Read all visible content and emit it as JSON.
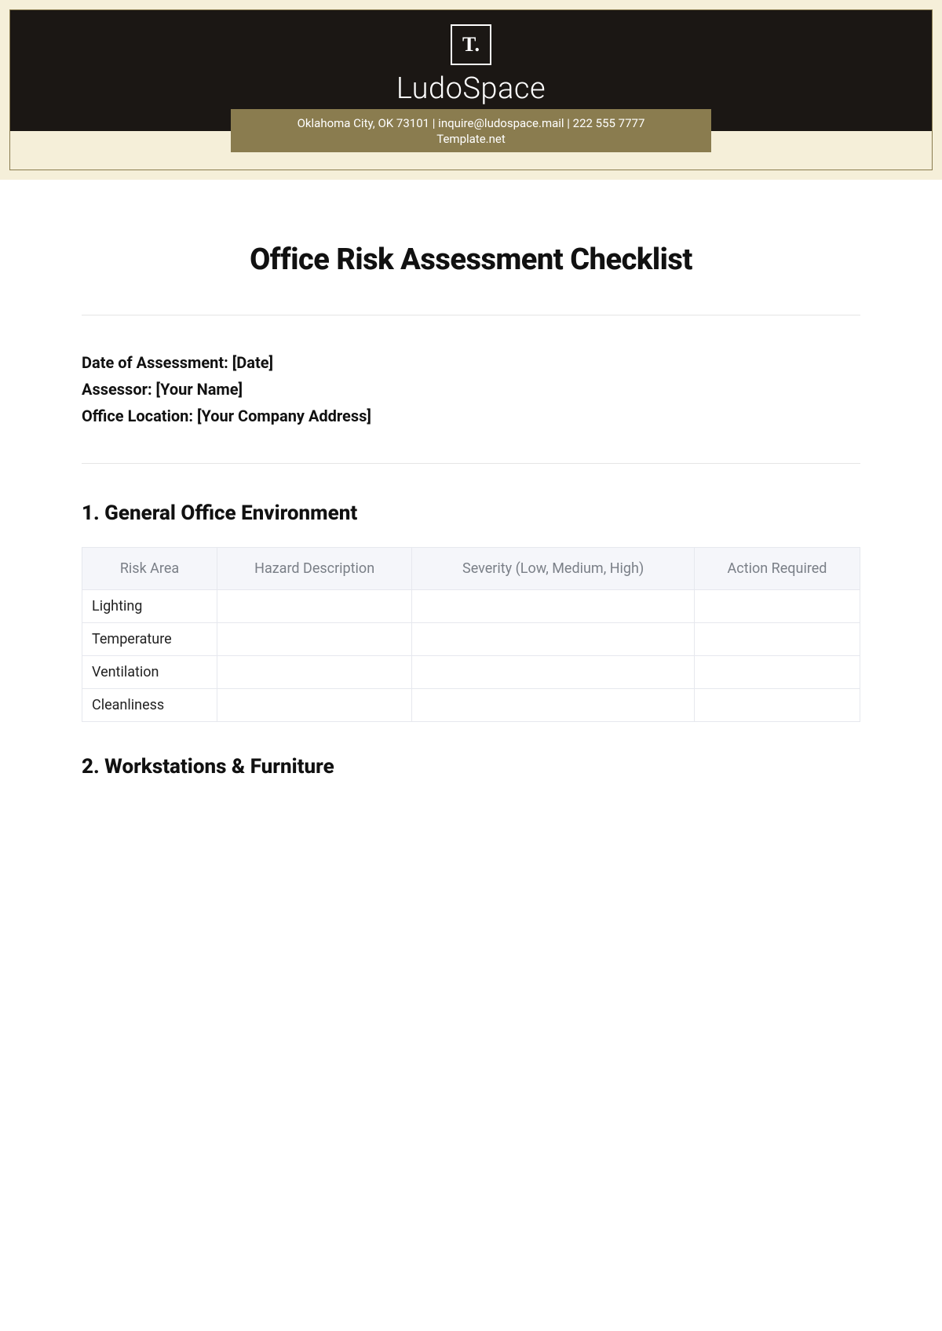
{
  "header": {
    "logo_text": "T.",
    "brand": "LudoSpace",
    "contact_line": "Oklahoma City, OK 73101 | inquire@ludospace.mail | 222 555 7777",
    "subline": "Template.net"
  },
  "title": "Office Risk Assessment Checklist",
  "meta": {
    "date_label": "Date of Assessment: [Date]",
    "assessor_label": "Assessor: [Your Name]",
    "location_label": "Office Location: [Your Company Address]"
  },
  "sections": [
    {
      "heading": "1. General Office Environment",
      "columns": [
        "Risk Area",
        "Hazard Description",
        "Severity (Low, Medium, High)",
        "Action Required"
      ],
      "rows": [
        "Lighting",
        "Temperature",
        "Ventilation",
        "Cleanliness"
      ]
    },
    {
      "heading": "2. Workstations & Furniture"
    }
  ]
}
